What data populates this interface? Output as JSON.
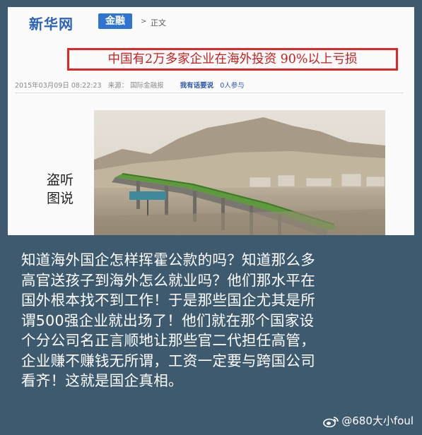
{
  "news": {
    "site_logo": "新华网",
    "channel_badge": "金融",
    "breadcrumb": "正文",
    "headline": "中国有2万多家企业在海外投资 90%以上亏损",
    "meta": {
      "datetime": "2015年03月09日 08:22:23",
      "source_label": "来源：",
      "source": "国际金融报",
      "link": "我有话要说",
      "count": "0人参与"
    }
  },
  "caption": {
    "line1": "盗听",
    "line2": "图说"
  },
  "body": {
    "lines": [
      "知道海外国企怎样挥霍公款的吗？知道那么多",
      "高官送孩子到海外怎么就业吗？他们那水平在",
      "国外根本找不到工作！于是那些国企尤其是所",
      "谓500强企业就出场了！他们就在那个国家设",
      "个分公司名正言顺地让那些官二代担任高管，",
      "企业赚不赚钱无所谓，工资一定要与跨国公司",
      "看齐！这就是国企真相。"
    ]
  },
  "watermark": {
    "text": "@680大小foul"
  },
  "colors": {
    "background": "#3d5a6e",
    "headline_border": "#e02626",
    "headline_text": "#c81e1e",
    "logo": "#2b63b8",
    "badge": "#2f74d0"
  }
}
